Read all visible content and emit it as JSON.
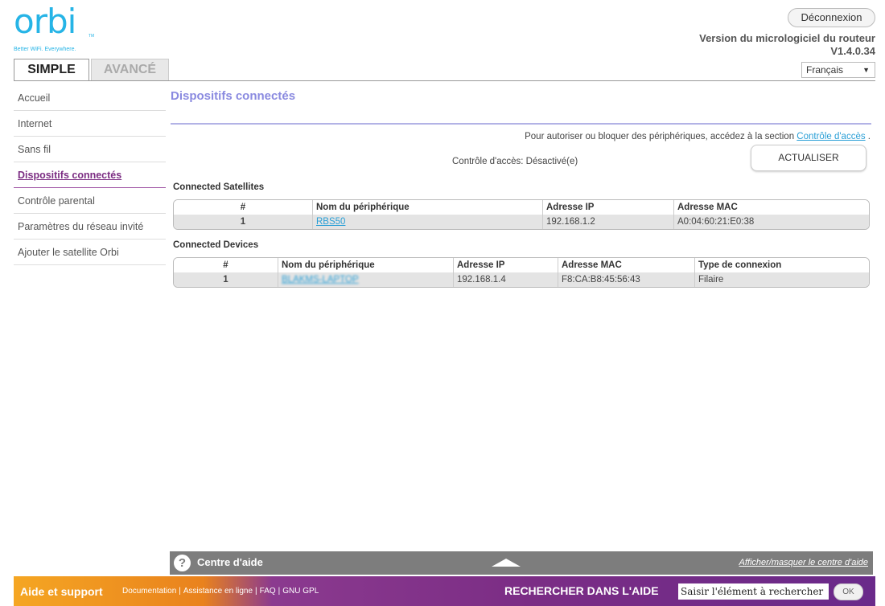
{
  "header": {
    "logo_text": "orbi",
    "logo_tm": "TM",
    "tagline": "Better WiFi. Everywhere.",
    "logout_label": "Déconnexion",
    "firmware_title": "Version du micrologiciel du routeur",
    "firmware_version": "V1.4.0.34",
    "language": "Français",
    "tabs": [
      {
        "label": "SIMPLE",
        "active": true
      },
      {
        "label": "AVANCÉ",
        "active": false
      }
    ]
  },
  "sidebar": {
    "items": [
      {
        "label": "Accueil"
      },
      {
        "label": "Internet"
      },
      {
        "label": "Sans fil"
      },
      {
        "label": "Dispositifs connectés",
        "active": true
      },
      {
        "label": "Contrôle parental"
      },
      {
        "label": "Paramètres du réseau invité"
      },
      {
        "label": "Ajouter le satellite Orbi"
      }
    ]
  },
  "main": {
    "title": "Dispositifs connectés",
    "access_note": "Pour autoriser ou bloquer des périphériques, accédez à la section",
    "access_link": "Contrôle d'accès",
    "access_note_end": ".",
    "access_status": "Contrôle d'accès: Désactivé(e)",
    "refresh_label": "ACTUALISER",
    "satellites": {
      "label": "Connected Satellites",
      "headers": [
        "#",
        "Nom du périphérique",
        "Adresse IP",
        "Adresse MAC"
      ],
      "rows": [
        [
          "1",
          "RBS50",
          "192.168.1.2",
          "A0:04:60:21:E0:38"
        ]
      ]
    },
    "devices": {
      "label": "Connected Devices",
      "headers": [
        "#",
        "Nom du périphérique",
        "Adresse IP",
        "Adresse MAC",
        "Type de connexion"
      ],
      "rows": [
        [
          "1",
          "BLAKMS-LAPTOP",
          "192.168.1.4",
          "F8:CA:B8:45:56:43",
          "Filaire"
        ]
      ]
    }
  },
  "help": {
    "title": "Centre d'aide",
    "toggle_label": "Afficher/masquer le centre d'aide"
  },
  "footer": {
    "title": "Aide et support",
    "links": [
      "Documentation",
      "Assistance en ligne",
      "FAQ",
      "GNU GPL"
    ],
    "search_label": "RECHERCHER DANS L'AIDE",
    "search_placeholder": "Saisir l'élément à rechercher",
    "ok_label": "OK"
  },
  "colors": {
    "brand_blue": "#26b4e6",
    "title_purple": "#8a8ae0",
    "active_purple": "#7b2c82",
    "footer_orange": "#f5a623",
    "footer_purple": "#7b2d85"
  }
}
